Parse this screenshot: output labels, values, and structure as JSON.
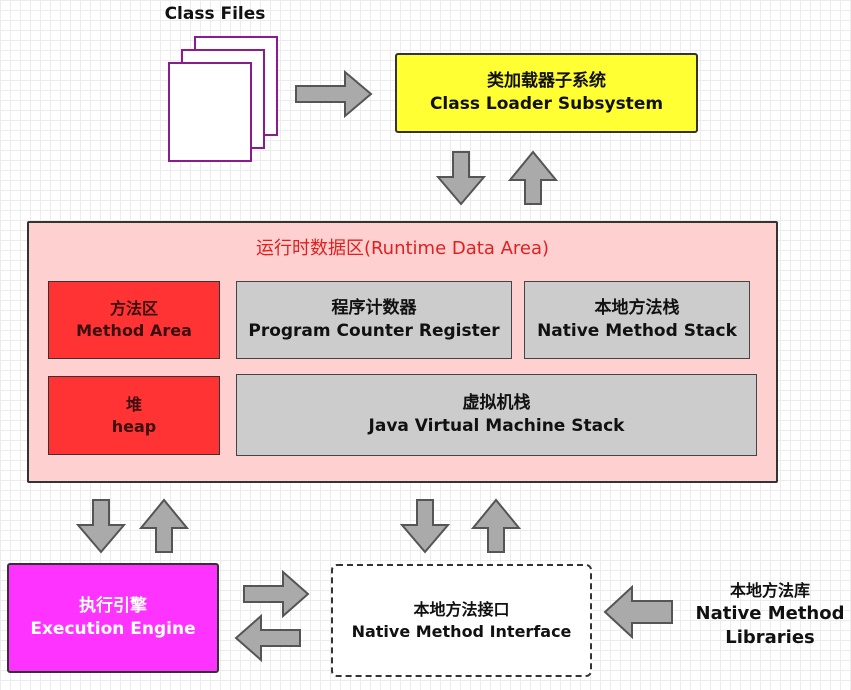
{
  "class_files": {
    "label": "Class Files"
  },
  "class_loader": {
    "zh": "类加载器子系统",
    "en": "Class Loader Subsystem",
    "color": "#ffff33"
  },
  "runtime_data_area": {
    "title": "运行时数据区(Runtime Data Area)",
    "title_color": "#e02020",
    "background": "#ffd0d0",
    "method_area": {
      "zh": "方法区",
      "en": "Method Area"
    },
    "pc_register": {
      "zh": "程序计数器",
      "en": "Program Counter Register"
    },
    "native_method_stack": {
      "zh": "本地方法栈",
      "en": "Native Method Stack"
    },
    "heap": {
      "zh": "堆",
      "en": "heap"
    },
    "jvm_stack": {
      "zh": "虚拟机栈",
      "en": "Java Virtual Machine Stack"
    }
  },
  "execution_engine": {
    "zh": "执行引擎",
    "en": "Execution Engine",
    "color": "#ff33ff"
  },
  "native_method_interface": {
    "zh": "本地方法接口",
    "en": "Native Method Interface"
  },
  "native_method_libraries": {
    "zh": "本地方法库",
    "en_line1": "Native Method",
    "en_line2": "Libraries"
  }
}
